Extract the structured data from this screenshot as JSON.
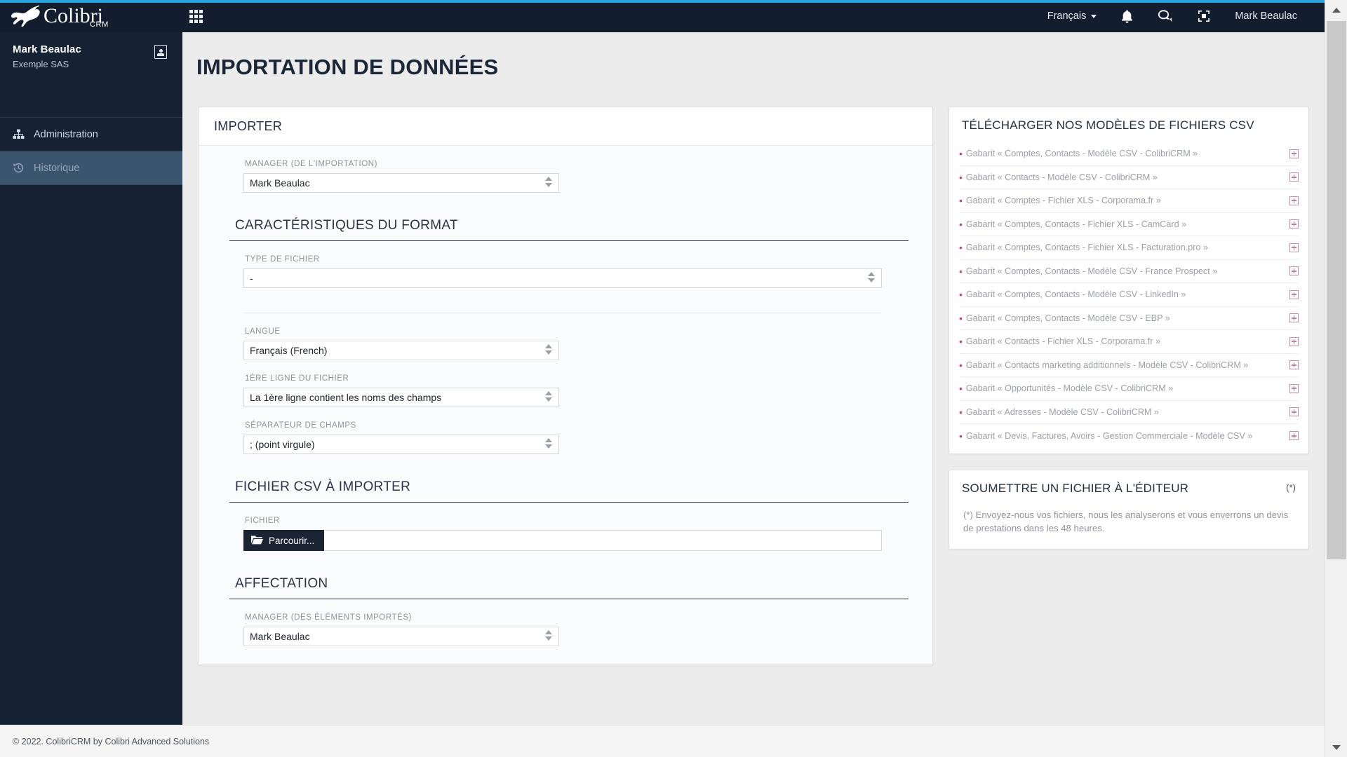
{
  "brand": {
    "name": "Colibri",
    "suffix": "CRM",
    "grid_icon": "apps-grid-icon"
  },
  "topbar": {
    "language": "Français",
    "bell_icon": "bell-icon",
    "chat_icon": "chat-icon",
    "fullscreen_icon": "fullscreen-icon",
    "user": "Mark Beaulac"
  },
  "sidebar": {
    "user_name": "Mark Beaulac",
    "company": "Exemple SAS",
    "card_icon": "contact-card-icon",
    "items": [
      {
        "label": "Administration",
        "icon": "org-chart-icon",
        "active": false
      },
      {
        "label": "Historique",
        "icon": "history-clock-icon",
        "active": true
      }
    ]
  },
  "page": {
    "title": "IMPORTATION DE DONNÉES"
  },
  "importer": {
    "card_title": "IMPORTER",
    "manager_label": "MANAGER (DE L'IMPORTATION)",
    "manager_value": "Mark Beaulac",
    "format_section": "CARACTÉRISTIQUES DU FORMAT",
    "file_type_label": "TYPE DE FICHIER",
    "file_type_value": "-",
    "language_label": "LANGUE",
    "language_value": "Français (French)",
    "first_line_label": "1ÈRE LIGNE DU FICHIER",
    "first_line_value": "La 1ère ligne contient les noms des champs",
    "separator_label": "SÉPARATEUR DE CHAMPS",
    "separator_value": ";  (point virgule)",
    "csv_section": "FICHIER CSV À IMPORTER",
    "file_label": "FICHIER",
    "browse_button": "Parcourir...",
    "browse_icon": "open-folder-icon",
    "file_input_value": "",
    "affectation_section": "AFFECTATION",
    "assign_manager_label": "MANAGER (DES ÉLÉMENTS IMPORTÉS)",
    "assign_manager_value": "Mark Beaulac"
  },
  "templates_panel": {
    "title": "TÉLÉCHARGER NOS MODÈLES DE FICHIERS CSV",
    "add_icon": "plus-box-icon",
    "items": [
      "Gabarit « Comptes, Contacts - Modèle CSV - ColibriCRM »",
      "Gabarit « Contacts - Modèle CSV - ColibriCRM »",
      "Gabarit « Comptes - Fichier XLS - Corporama.fr »",
      "Gabarit « Comptes, Contacts - Fichier XLS - CamCard »",
      "Gabarit « Comptes, Contacts - Fichier XLS - Facturation.pro »",
      "Gabarit « Comptes, Contacts - Modèle CSV - France Prospect »",
      "Gabarit « Comptes, Contacts - Modèle CSV - LinkedIn »",
      "Gabarit « Comptes, Contacts - Modèle CSV - EBP »",
      "Gabarit « Contacts - Fichier XLS - Corporama.fr »",
      "Gabarit « Contacts marketing additionnels - Modèle CSV - ColibriCRM »",
      "Gabarit « Opportunités - Modèle CSV - ColibriCRM »",
      "Gabarit « Adresses - Modèle CSV - ColibriCRM »",
      "Gabarit « Devis, Factures, Avoirs - Gestion Commerciale - Modèle CSV »"
    ]
  },
  "submit_panel": {
    "title": "SOUMETTRE UN FICHIER À L'ÉDITEUR",
    "marker": "(*)",
    "note": "(*) Envoyez-nous vos fichiers, nous les analyserons et vous enverrons un devis de prestations dans les 48 heures."
  },
  "footer": {
    "text": "© 2022. ColibriCRM by Colibri Advanced Solutions"
  },
  "colors": {
    "accent": "#29a3dd",
    "topbar": "#121d2e",
    "sidebar": "#152233",
    "sidebar_active": "#3b556f",
    "template_accent": "#b0506a",
    "dark_button": "#1b2433"
  }
}
